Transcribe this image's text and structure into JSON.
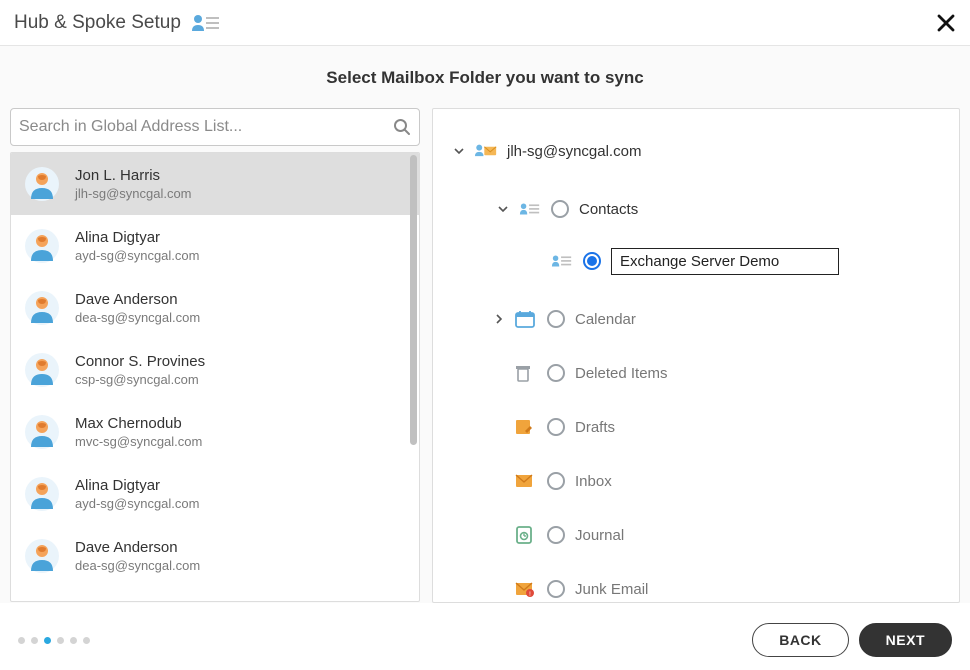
{
  "header": {
    "title": "Hub & Spoke Setup"
  },
  "subheading": "Select Mailbox Folder you want to sync",
  "search": {
    "placeholder": "Search in Global Address List...",
    "value": ""
  },
  "contacts": [
    {
      "name": "Jon L. Harris",
      "email": "jlh-sg@syncgal.com",
      "selected": true
    },
    {
      "name": "Alina Digtyar",
      "email": "ayd-sg@syncgal.com",
      "selected": false
    },
    {
      "name": "Dave Anderson",
      "email": "dea-sg@syncgal.com",
      "selected": false
    },
    {
      "name": "Connor S. Provines",
      "email": "csp-sg@syncgal.com",
      "selected": false
    },
    {
      "name": "Max Chernodub",
      "email": "mvc-sg@syncgal.com",
      "selected": false
    },
    {
      "name": "Alina Digtyar",
      "email": "ayd-sg@syncgal.com",
      "selected": false
    },
    {
      "name": "Dave Anderson",
      "email": "dea-sg@syncgal.com",
      "selected": false
    }
  ],
  "tree": {
    "mailbox": "jlh-sg@syncgal.com",
    "contacts_label": "Contacts",
    "selected_folder_value": "Exchange Server Demo",
    "folders": [
      {
        "key": "calendar",
        "label": "Calendar",
        "expandable": true
      },
      {
        "key": "deleted",
        "label": "Deleted Items",
        "expandable": false
      },
      {
        "key": "drafts",
        "label": "Drafts",
        "expandable": false
      },
      {
        "key": "inbox",
        "label": "Inbox",
        "expandable": false
      },
      {
        "key": "journal",
        "label": "Journal",
        "expandable": false
      },
      {
        "key": "junk",
        "label": "Junk Email",
        "expandable": false
      }
    ]
  },
  "footer": {
    "back": "BACK",
    "next": "NEXT",
    "step_count": 6,
    "active_step": 3
  }
}
